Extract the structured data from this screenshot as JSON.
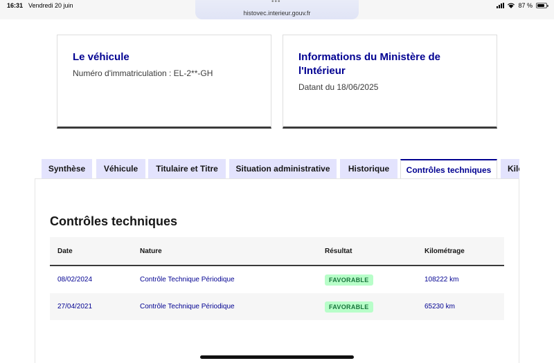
{
  "status_bar": {
    "time": "16:31",
    "date": "Vendredi 20 juin",
    "url": "histovec.interieur.gouv.fr",
    "battery": "87 %",
    "battery_level": 0.87
  },
  "cards": {
    "vehicle": {
      "title": "Le véhicule",
      "subtitle": "Numéro d'immatriculation : EL-2**-GH"
    },
    "ministry": {
      "title": "Informations du Ministère de l'Intérieur",
      "subtitle": "Datant du 18/06/2025"
    }
  },
  "tabs": [
    {
      "label": "Synthèse",
      "active": false
    },
    {
      "label": "Véhicule",
      "active": false
    },
    {
      "label": "Titulaire et Titre",
      "active": false
    },
    {
      "label": "Situation administrative",
      "active": false
    },
    {
      "label": "Historique",
      "active": false
    },
    {
      "label": "Contrôles techniques",
      "active": true
    },
    {
      "label": "Kilo",
      "active": false
    }
  ],
  "section": {
    "title": "Contrôles techniques",
    "columns": [
      "Date",
      "Nature",
      "Résultat",
      "Kilométrage"
    ],
    "rows": [
      {
        "date": "08/02/2024",
        "nature": "Contrôle Technique Périodique",
        "result": "FAVORABLE",
        "mileage": "108222 km"
      },
      {
        "date": "27/04/2021",
        "nature": "Contrôle Technique Périodique",
        "result": "FAVORABLE",
        "mileage": "65230 km"
      }
    ]
  },
  "colors": {
    "accent": "#000091",
    "tab_bg": "#e3e3fd",
    "badge_bg": "#b8fec9",
    "badge_text": "#18753c"
  }
}
